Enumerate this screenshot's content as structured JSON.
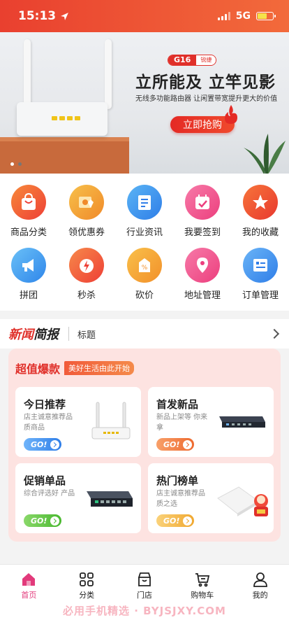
{
  "status_bar": {
    "time": "15:13",
    "network": "5G"
  },
  "banner": {
    "model_badge": "G16",
    "model_badge_brand": "锐捷",
    "title": "立所能及  立竿见影",
    "subtitle": "无线多功能路由器 让闲置带宽提升更大的价值",
    "cta": "立即抢购",
    "page_count": 2,
    "active_page": 1
  },
  "grid": [
    {
      "label": "商品分类",
      "icon": "shopping-bag-icon",
      "color": "#f0553a"
    },
    {
      "label": "领优惠券",
      "icon": "coupon-icon",
      "color": "#f2a03a"
    },
    {
      "label": "行业资讯",
      "icon": "news-doc-icon",
      "color": "#3a8cf0"
    },
    {
      "label": "我要签到",
      "icon": "calendar-check-icon",
      "color": "#f04a8a"
    },
    {
      "label": "我的收藏",
      "icon": "star-icon",
      "color": "#f0503a"
    },
    {
      "label": "拼团",
      "icon": "megaphone-icon",
      "color": "#3a9cf0"
    },
    {
      "label": "秒杀",
      "icon": "lightning-clock-icon",
      "color": "#f05a3a"
    },
    {
      "label": "砍价",
      "icon": "discount-tag-icon",
      "color": "#f59a3a"
    },
    {
      "label": "地址管理",
      "icon": "location-pin-icon",
      "color": "#f04a8a"
    },
    {
      "label": "订单管理",
      "icon": "order-list-icon",
      "color": "#3a8cf0"
    }
  ],
  "news": {
    "logo_part1": "新闻",
    "logo_part2": "简报",
    "title": "标题"
  },
  "deals": {
    "title": "超值爆款",
    "tag": "美好生活由此开始",
    "cards": [
      {
        "title": "今日推荐",
        "desc": "店主诚意推荐品质商品",
        "go": "GO!",
        "go_color": "#3a86f0"
      },
      {
        "title": "首发新品",
        "desc": "新品上架等 你来拿",
        "go": "GO!",
        "go_color": "#f07a3a"
      },
      {
        "title": "促销单品",
        "desc": "综合评选好 产品",
        "go": "GO!",
        "go_color": "#5ac23a"
      },
      {
        "title": "热门榜单",
        "desc": "店主诚意推荐品质之选",
        "go": "GO!",
        "go_color": "#f0b43a"
      }
    ]
  },
  "tabbar": [
    {
      "label": "首页",
      "icon": "home-icon",
      "active": true
    },
    {
      "label": "分类",
      "icon": "grid-icon",
      "active": false
    },
    {
      "label": "门店",
      "icon": "store-icon",
      "active": false
    },
    {
      "label": "购物车",
      "icon": "cart-icon",
      "active": false
    },
    {
      "label": "我的",
      "icon": "user-icon",
      "active": false
    }
  ],
  "watermark": "必用手机精选 · BYJSJXY.COM",
  "colors": {
    "primary": "#e0302a",
    "tab_active": "#e23a7b"
  }
}
